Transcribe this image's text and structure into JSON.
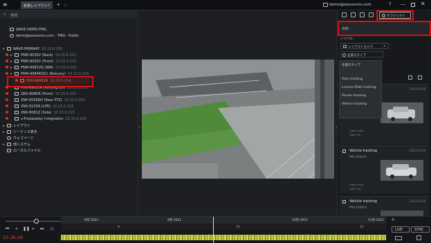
{
  "topbar": {
    "tab_label": "新規レイアウト",
    "user": "demo@wavevms.com",
    "help": "?",
    "minimize": "—",
    "close": "✕"
  },
  "left": {
    "search_placeholder": "検索",
    "site_name": "WAVE-DEMO-TMG",
    "site_sub": "demo@wavevms.com - TMG - Public",
    "tree": [
      {
        "label": "WAVE-PRIMARY",
        "ip": "10.15.0.200"
      },
      {
        "label": "PNM-9030V (Back)",
        "ip": "10.15.0.202"
      },
      {
        "label": "PNM-9030V (Front)",
        "ip": "10.15.0.215"
      },
      {
        "label": "PNM-9081VQ (NW)",
        "ip": "10.15.0.203"
      },
      {
        "label": "PNM-9084RQZ1 (Balcony)",
        "ip": "10.15.0.214"
      },
      {
        "label": "PNV-A9081R",
        "ip": "10.15.0.214"
      },
      {
        "label": "PNV-A9081R (Parking Lot)",
        "ip": "10.15.0.211"
      },
      {
        "label": "QNV-8080R (Front)",
        "ip": "10.15.0.252"
      },
      {
        "label": "XNP-6550RH (Rear PTZ)",
        "ip": "10.15.0.201"
      },
      {
        "label": "XNV-6120R (LPR)",
        "ip": "10.15.0.216"
      },
      {
        "label": "XNV-8081Z (Side)",
        "ip": "10.15.0.215"
      },
      {
        "label": "z-Prodatakey Integration",
        "ip": "10.15.0.229"
      },
      {
        "label": "レイアウト",
        "ip": ""
      },
      {
        "label": "シーケンス表示",
        "ip": ""
      },
      {
        "label": "ウェブページ",
        "ip": ""
      },
      {
        "label": "他システム",
        "ip": ""
      },
      {
        "label": "ローカルファイル",
        "ip": ""
      }
    ]
  },
  "right": {
    "notification_label": "オブジェクト",
    "search_placeholder": "検索",
    "filter_any": "いつでも",
    "filter_chip": "レイアウトカメラ",
    "type_select": "任意のタイプ",
    "dropdown": {
      "head": "任意のタイプ",
      "items": [
        "Face tracking",
        "License Plate tracking",
        "Person tracking",
        "Vehicle tracking"
      ]
    },
    "cards": [
      {
        "title": "Vehicle tracking",
        "time": "2021/11/08",
        "camera": "PNV-A9081R",
        "color": "Gray",
        "type": "Car"
      },
      {
        "title": "Vehicle tracking",
        "time": "2021/11/08",
        "camera": "PNV-A9081R",
        "color": "Gray",
        "type": "Car"
      },
      {
        "title": "Vehicle tracking",
        "time": "2021/11/08",
        "camera": "PNV-A9081R",
        "color": "",
        "type": ""
      }
    ],
    "attr_color_label": "Color",
    "attr_type_label": "Type"
  },
  "timeline": {
    "dates": [
      "8月 2021",
      "9月 2021",
      "10月 2021",
      "11月 2021"
    ],
    "hours": [
      "8",
      "10",
      "12"
    ],
    "current_time": "13:26:10",
    "zoom": "-0",
    "live": "LIVE",
    "sync": "SYNC"
  },
  "colors": {
    "accent": "#e01010",
    "timeline_bar": "#b9c23a",
    "selected_text": "#ff6a5e"
  }
}
